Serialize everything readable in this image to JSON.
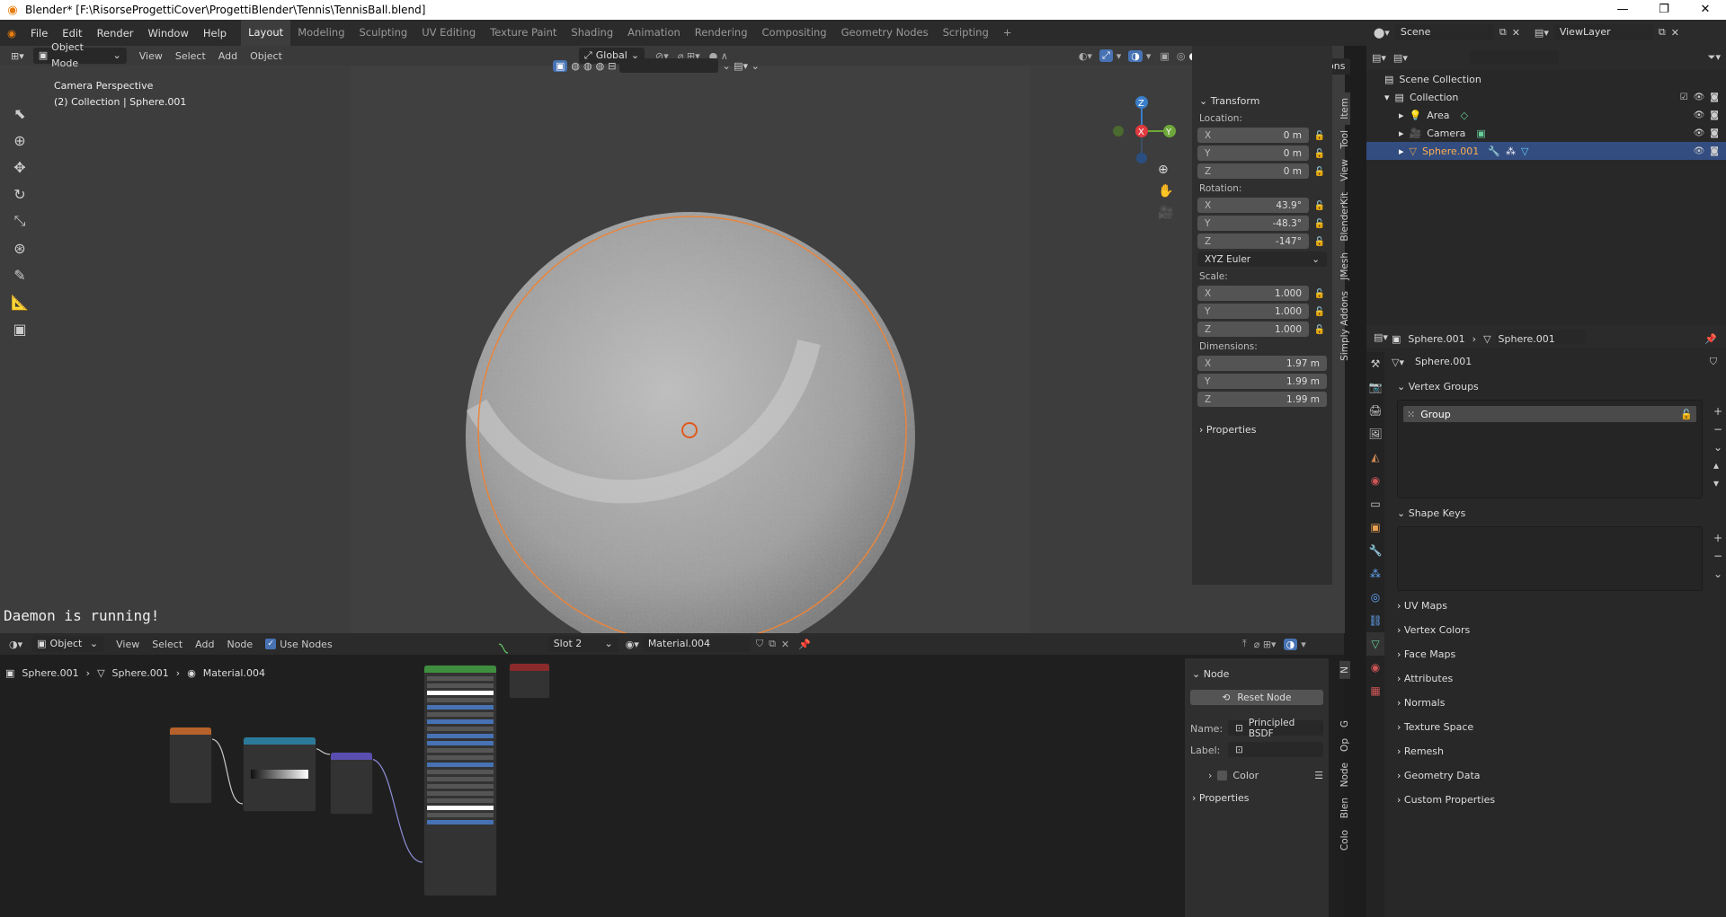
{
  "titlebar": {
    "title": "Blender* [F:\\RisorseProgettiCover\\ProgettiBlender\\Tennis\\TennisBall.blend]"
  },
  "menu": [
    "File",
    "Edit",
    "Render",
    "Window",
    "Help"
  ],
  "workspaces": [
    "Layout",
    "Modeling",
    "Sculpting",
    "UV Editing",
    "Texture Paint",
    "Shading",
    "Animation",
    "Rendering",
    "Compositing",
    "Geometry Nodes",
    "Scripting"
  ],
  "viewport": {
    "mode": "Object Mode",
    "menus": [
      "View",
      "Select",
      "Add",
      "Object"
    ],
    "orientation": "Global",
    "options": "Options",
    "camera_label": "Camera Perspective",
    "collection_label": "(2) Collection | Sphere.001",
    "daemon": "Daemon is running!",
    "gizmo": {
      "x": "X",
      "y": "Y",
      "z": "Z"
    }
  },
  "npanel": {
    "transform": "Transform",
    "location_label": "Location:",
    "location": [
      {
        "axis": "X",
        "value": "0 m"
      },
      {
        "axis": "Y",
        "value": "0 m"
      },
      {
        "axis": "Z",
        "value": "0 m"
      }
    ],
    "rotation_label": "Rotation:",
    "rotation": [
      {
        "axis": "X",
        "value": "43.9°"
      },
      {
        "axis": "Y",
        "value": "-48.3°"
      },
      {
        "axis": "Z",
        "value": "-147°"
      }
    ],
    "rotation_mode": "XYZ Euler",
    "scale_label": "Scale:",
    "scale": [
      {
        "axis": "X",
        "value": "1.000"
      },
      {
        "axis": "Y",
        "value": "1.000"
      },
      {
        "axis": "Z",
        "value": "1.000"
      }
    ],
    "dimensions_label": "Dimensions:",
    "dimensions": [
      {
        "axis": "X",
        "value": "1.97 m"
      },
      {
        "axis": "Y",
        "value": "1.99 m"
      },
      {
        "axis": "Z",
        "value": "1.99 m"
      }
    ],
    "properties": "Properties",
    "tabs": [
      "Item",
      "Tool",
      "View",
      "BlenderKit",
      "JMesh",
      "Simply Addons"
    ]
  },
  "node_editor": {
    "type": "Object",
    "menus": [
      "View",
      "Select",
      "Add",
      "Node"
    ],
    "use_nodes": "Use Nodes",
    "slot": "Slot 2",
    "material": "Material.004",
    "breadcrumb": [
      "Sphere.001",
      "Sphere.001",
      "Material.004"
    ],
    "panel": {
      "section": "Node",
      "reset": "Reset Node",
      "name_label": "Name:",
      "name": "Principled BSDF",
      "label_label": "Label:",
      "label": "",
      "color": "Color",
      "properties": "Properties"
    },
    "tabs": [
      "N",
      "G",
      "Op",
      "Node",
      "Blen",
      "Colo"
    ]
  },
  "outliner": {
    "scene": "Scene",
    "view_layer": "ViewLayer",
    "scene_collection": "Scene Collection",
    "items": [
      "Collection",
      "Area",
      "Camera",
      "Sphere.001"
    ]
  },
  "properties": {
    "object": "Sphere.001",
    "mesh": "Sphere.001",
    "data_name": "Sphere.001",
    "sections": [
      "Vertex Groups",
      "Shape Keys",
      "UV Maps",
      "Vertex Colors",
      "Face Maps",
      "Attributes",
      "Normals",
      "Texture Space",
      "Remesh",
      "Geometry Data",
      "Custom Properties"
    ],
    "group": "Group"
  },
  "colors": {
    "accent": "#4772b3",
    "selection": "#334d80",
    "outline": "#e8853d",
    "x_axis": "#e0393e",
    "y_axis": "#6fa83a",
    "z_axis": "#3a7ec9"
  }
}
